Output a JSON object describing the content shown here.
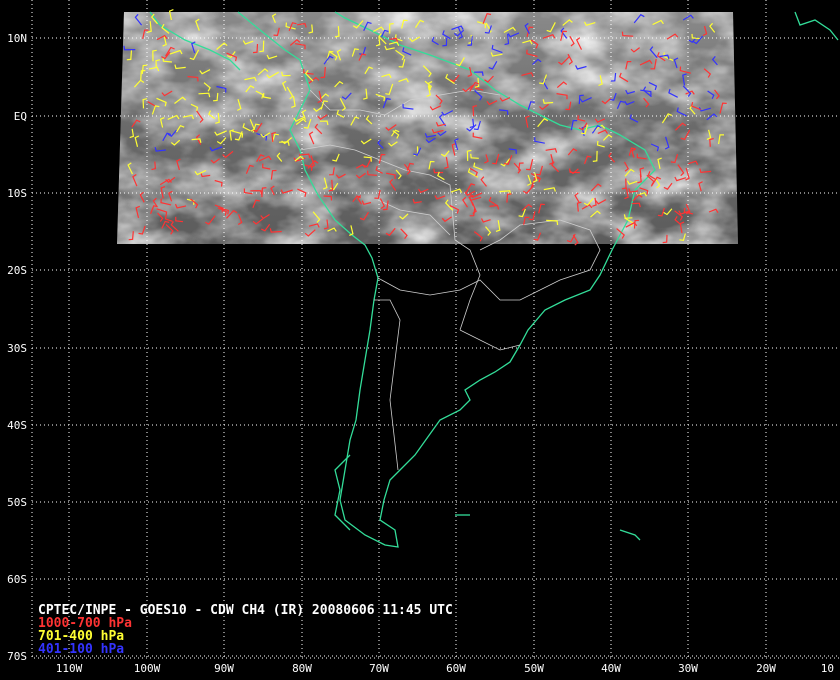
{
  "lat_labels": [
    "10N",
    "EQ",
    "10S",
    "20S",
    "30S",
    "40S",
    "50S",
    "60S",
    "70S"
  ],
  "lon_labels": [
    "110W",
    "100W",
    "90W",
    "80W",
    "70W",
    "60W",
    "50W",
    "40W",
    "30W",
    "20W",
    "10"
  ],
  "caption": {
    "title": "CPTEC/INPE - GOES10 - CDW CH4 (IR) 20080606 11:45 UTC",
    "legend": [
      {
        "label": "1000-700 hPa",
        "color": "#ff3333"
      },
      {
        "label": "701-400 hPa",
        "color": "#ffff33"
      },
      {
        "label": "401-100 hPa",
        "color": "#3333ff"
      }
    ]
  },
  "colors": {
    "background": "#000000",
    "coastline": "#33dd99",
    "borders": "#cccccc",
    "grid": "#ffffff"
  }
}
